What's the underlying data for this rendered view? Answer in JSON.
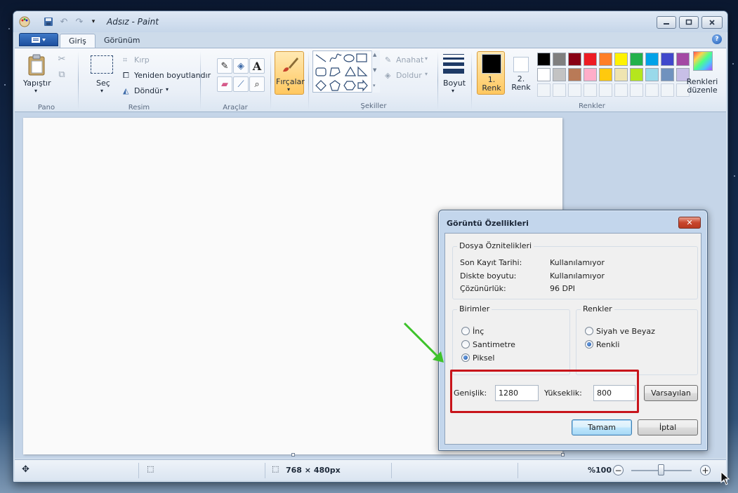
{
  "window": {
    "title": "Adsız - Paint"
  },
  "tabs": [
    {
      "label": "Giriş",
      "active": true
    },
    {
      "label": "Görünüm",
      "active": false
    }
  ],
  "ribbon": {
    "pano": {
      "label": "Pano",
      "paste": "Yapıştır"
    },
    "resim": {
      "label": "Resim",
      "select": "Seç",
      "crop": "Kırp",
      "resize": "Yeniden boyutlandır",
      "rotate": "Döndür"
    },
    "araclar": {
      "label": "Araçlar"
    },
    "brushes": "Fırçalar",
    "sekiller": {
      "label": "Şekiller",
      "outline": "Anahat",
      "fill": "Doldur"
    },
    "size": "Boyut",
    "renkler": {
      "label": "Renkler",
      "color1": "1. Renk",
      "color2": "2. Renk",
      "edit_colors": "Renkleri düzenle",
      "color1_value": "#000000",
      "color2_value": "#ffffff",
      "palette_row1": [
        "#000000",
        "#7f7f7f",
        "#880015",
        "#ed1c24",
        "#ff7f27",
        "#fff200",
        "#22b14c",
        "#00a2e8",
        "#3f48cc",
        "#a349a4"
      ],
      "palette_row2": [
        "#ffffff",
        "#c3c3c3",
        "#b97a57",
        "#ffaec9",
        "#ffc90e",
        "#efe4b0",
        "#b5e61d",
        "#99d9ea",
        "#7092be",
        "#c8bfe7"
      ]
    }
  },
  "statusbar": {
    "dimensions": "768 × 480px",
    "zoom": "%100"
  },
  "dialog": {
    "title": "Görüntü Özellikleri",
    "file_attributes": {
      "legend": "Dosya Öznitelikleri",
      "rows": [
        {
          "label": "Son Kayıt Tarihi:",
          "value": "Kullanılamıyor"
        },
        {
          "label": "Diskte boyutu:",
          "value": "Kullanılamıyor"
        },
        {
          "label": "Çözünürlük:",
          "value": "96 DPI"
        }
      ]
    },
    "units": {
      "legend": "Birimler",
      "options": [
        {
          "label": "İnç",
          "checked": false
        },
        {
          "label": "Santimetre",
          "checked": false
        },
        {
          "label": "Piksel",
          "checked": true
        }
      ]
    },
    "colors": {
      "legend": "Renkler",
      "options": [
        {
          "label": "Siyah ve Beyaz",
          "checked": false
        },
        {
          "label": "Renkli",
          "checked": true
        }
      ]
    },
    "width_label": "Genişlik:",
    "width_value": "1280",
    "height_label": "Yükseklik:",
    "height_value": "800",
    "defaults_button": "Varsayılan",
    "ok_button": "Tamam",
    "cancel_button": "İptal"
  },
  "accent": {
    "highlight": "#c8141b",
    "arrow": "#3dc22a"
  }
}
